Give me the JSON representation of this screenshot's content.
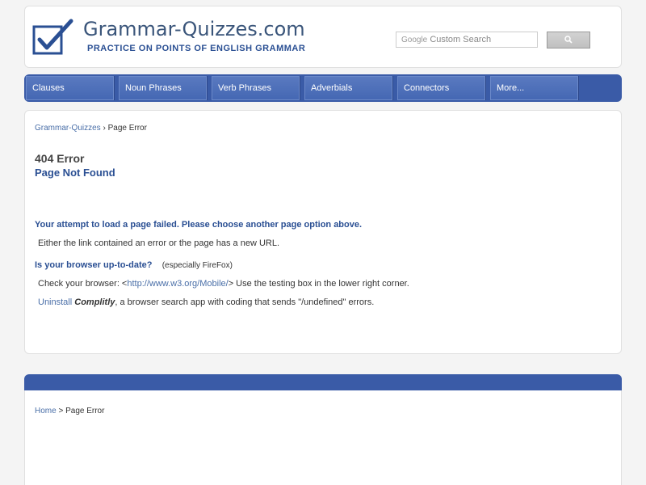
{
  "header": {
    "site_title": "Grammar-Quizzes.com",
    "tagline": "PRACTICE ON POINTS OF ENGLISH GRAMMAR",
    "logo_icon": "checkbox-check-icon",
    "search": {
      "brand": "Google",
      "placeholder": "Custom Search",
      "button_icon": "search-icon"
    }
  },
  "nav": {
    "items": [
      {
        "label": "Clauses"
      },
      {
        "label": "Noun Phrases"
      },
      {
        "label": "Verb Phrases"
      },
      {
        "label": "Adverbials"
      },
      {
        "label": "Connectors"
      },
      {
        "label": "More..."
      }
    ]
  },
  "main": {
    "breadcrumb": {
      "home": "Grammar-Quizzes",
      "separator": "›",
      "current": "Page Error"
    },
    "error_title": "404 Error",
    "error_subtitle": "Page Not Found",
    "message": "Your attempt to load a page failed. Please choose another page option above.",
    "reason": "Either the link contained an error or the page has a new URL.",
    "browser_question": "Is your browser up-to-date?",
    "browser_note": "(especially FireFox)",
    "check_prefix": "Check your browser: <",
    "check_link": "http://www.w3.org/Mobile/",
    "check_suffix": ">  Use the testing box in the lower right corner.",
    "uninstall_link": "Uninstall",
    "uninstall_app": "Complitly",
    "uninstall_rest": ", a browser search app with coding that sends \"/undefined\"  errors."
  },
  "footer": {
    "breadcrumb": {
      "home": "Home",
      "separator": ">",
      "current": "Page Error"
    }
  },
  "colors": {
    "nav_blue": "#3a5ba7",
    "title_blue": "#2a4f93",
    "link_blue": "#4a6fa8"
  }
}
